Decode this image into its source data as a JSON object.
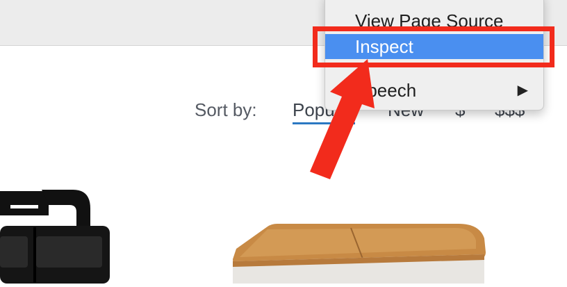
{
  "sort": {
    "label": "Sort by:",
    "options": [
      "Popular",
      "New",
      "$",
      "$$$"
    ],
    "active_index": 0,
    "accent_color": "#2b78c2"
  },
  "context_menu": {
    "items": [
      {
        "label": "View Page Source"
      },
      {
        "label": "Inspect",
        "highlighted": true
      },
      {
        "label": "Speech",
        "has_submenu": true
      }
    ],
    "submenu_arrow": "▶",
    "highlight_color": "#4a8ff0"
  },
  "annotation": {
    "color": "#f22b1c"
  },
  "products": [
    {
      "icon": "black-storage-caddy-image"
    },
    {
      "icon": "bamboo-lid-container-image"
    }
  ]
}
